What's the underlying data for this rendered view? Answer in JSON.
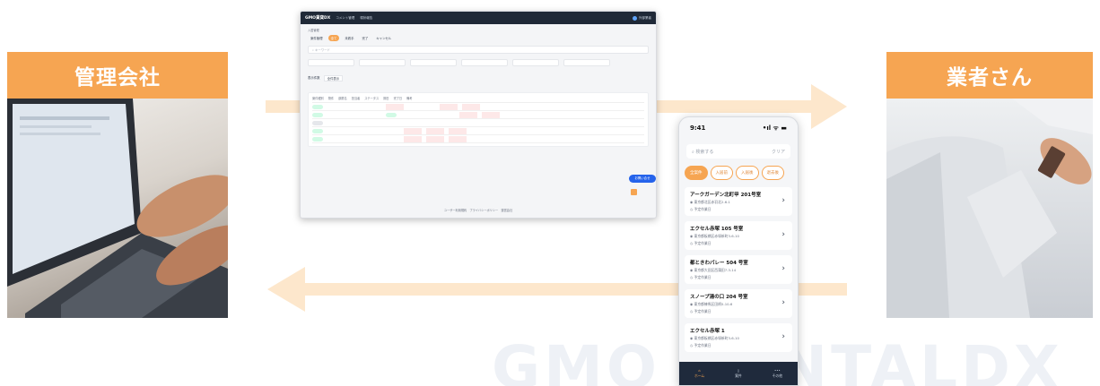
{
  "watermark": "GMO RENTALDX",
  "left_label": "管理会社",
  "right_label": "業者さん",
  "desktop": {
    "logo": "GMO賃貸DX",
    "nav": [
      "コメント管理",
      "現状報告"
    ],
    "user": "外部業者",
    "breadcrumb": "入居管理",
    "tabs": [
      "案件管理",
      "全て",
      "未着手",
      "完了",
      "キャンセル"
    ],
    "search_placeholder": "キーワード",
    "table_label": "表示件数",
    "table_select": "全件表示",
    "columns": [
      "案件種別",
      "物件",
      "部屋名",
      "担当者",
      "ステータス",
      "期日",
      "完了日",
      "備考"
    ],
    "footer": "ユーザー利用規約　プライバシーポリシー　運営会社",
    "chat_label": "お問い合せ"
  },
  "phone": {
    "time": "9:41",
    "signal": "•ıl ᯤ ▬",
    "search_placeholder": "検索する",
    "search_action": "クリア",
    "chips": [
      "全案件",
      "入居前",
      "入居後",
      "退去後"
    ],
    "cards": [
      {
        "title": "アークガーデン北町甲 201号室",
        "address": "東京都北区赤羽北2-6-1",
        "schedule": "予定作業日"
      },
      {
        "title": "エクセル赤塚 105 号室",
        "address": "東京都板橋区赤塚新町3-6-10",
        "schedule": "予定作業日"
      },
      {
        "title": "都ときわパレー 504 号室",
        "address": "東京都大田区西蒲田7-3-14",
        "schedule": "予定作業日"
      },
      {
        "title": "スノープ湯の口 204 号室",
        "address": "東京都練馬区田柄5-10-6",
        "schedule": "予定作業日"
      },
      {
        "title": "エクセル赤塚 1",
        "address": "東京都板橋区赤塚新町3-6-10",
        "schedule": "予定作業日"
      }
    ],
    "nav": [
      "ホーム",
      "案件",
      "その他"
    ]
  }
}
